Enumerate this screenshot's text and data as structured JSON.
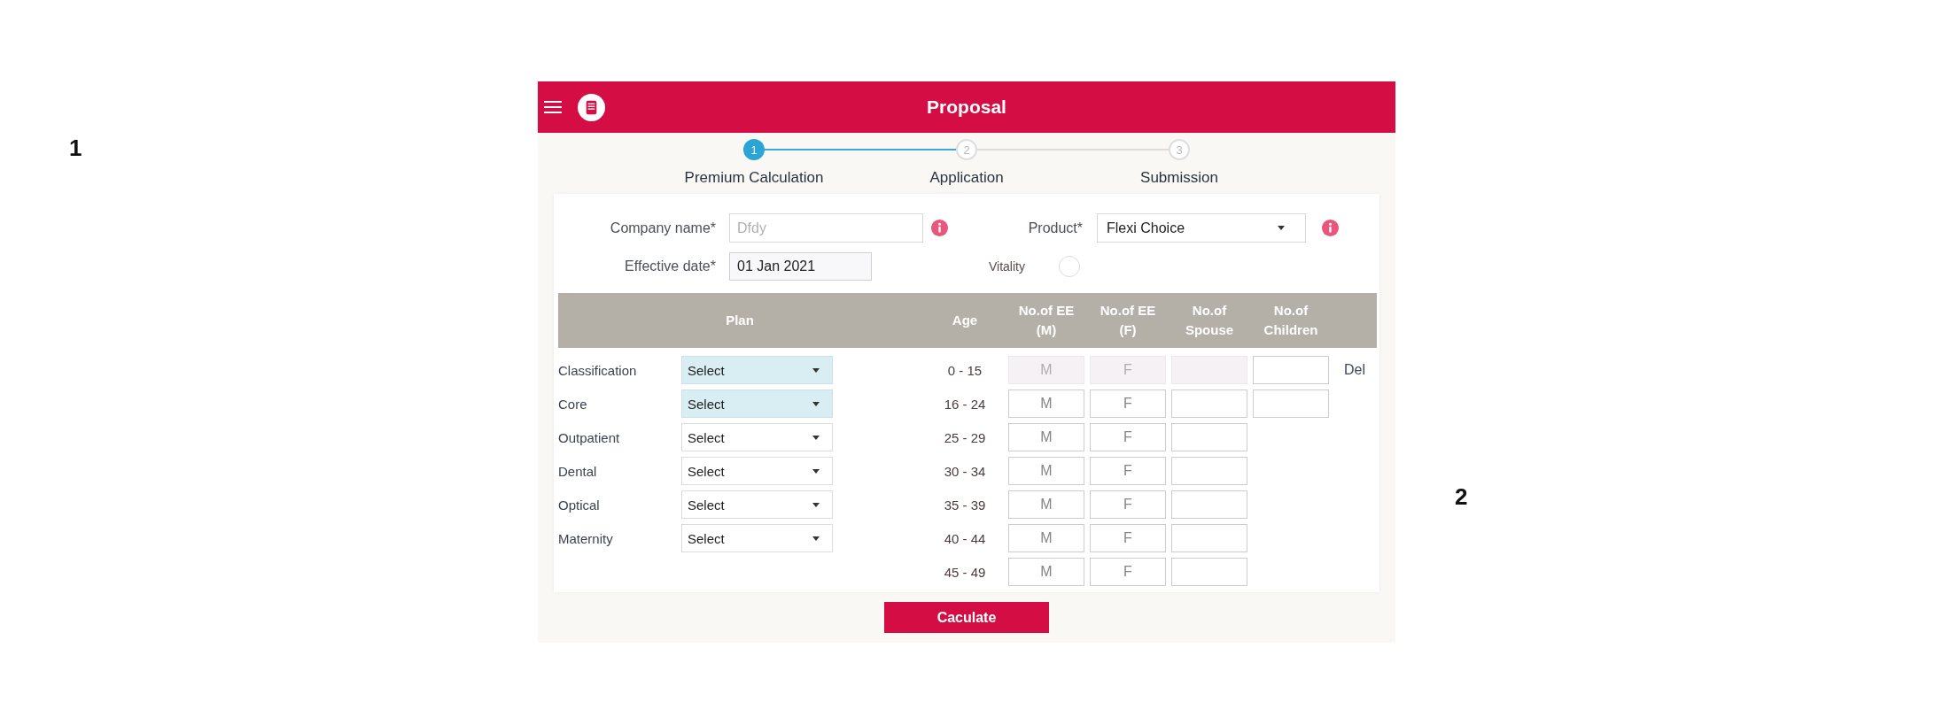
{
  "annotations": [
    "1",
    "2"
  ],
  "header": {
    "title": "Proposal"
  },
  "stepper": [
    {
      "number": "1",
      "label": "Premium Calculation",
      "selected": true
    },
    {
      "number": "2",
      "label": "Application",
      "selected": false
    },
    {
      "number": "3",
      "label": "Submission",
      "selected": false
    }
  ],
  "form": {
    "company_name": {
      "label": "Company name*",
      "placeholder": "Dfdy"
    },
    "product": {
      "label": "Product*",
      "value": "Flexi Choice"
    },
    "effective_date": {
      "label": "Effective date*",
      "value": "01 Jan 2021"
    },
    "vitality": {
      "label": "Vitality",
      "checked": false
    }
  },
  "table": {
    "columns": [
      "Plan",
      "Age",
      "No.of EE (M)",
      "No.of EE (F)",
      "No.of Spouse",
      "No.of Children"
    ],
    "plans": [
      {
        "label": "Classification",
        "value": "Select",
        "highlighted": true
      },
      {
        "label": "Core",
        "value": "Select",
        "highlighted": true
      },
      {
        "label": "Outpatient",
        "value": "Select",
        "highlighted": false
      },
      {
        "label": "Dental",
        "value": "Select",
        "highlighted": false
      },
      {
        "label": "Optical",
        "value": "Select",
        "highlighted": false
      },
      {
        "label": "Maternity",
        "value": "Select",
        "highlighted": false
      }
    ],
    "age_bands": [
      {
        "age": "0 - 15",
        "fields": [
          {
            "placeholder": "M",
            "disabled": true
          },
          {
            "placeholder": "F",
            "disabled": true
          },
          {
            "disabled": true
          },
          {
            "disabled": false
          }
        ],
        "delete_label": "Del"
      },
      {
        "age": "16 - 24",
        "fields": [
          {
            "placeholder": "M",
            "disabled": false
          },
          {
            "placeholder": "F",
            "disabled": false
          },
          {
            "disabled": false
          },
          {
            "disabled": false
          }
        ]
      },
      {
        "age": "25 - 29",
        "fields": [
          {
            "placeholder": "M",
            "disabled": false
          },
          {
            "placeholder": "F",
            "disabled": false
          },
          {
            "disabled": false
          }
        ]
      },
      {
        "age": "30 - 34",
        "fields": [
          {
            "placeholder": "M",
            "disabled": false
          },
          {
            "placeholder": "F",
            "disabled": false
          },
          {
            "disabled": false
          }
        ]
      },
      {
        "age": "35 - 39",
        "fields": [
          {
            "placeholder": "M",
            "disabled": false
          },
          {
            "placeholder": "F",
            "disabled": false
          },
          {
            "disabled": false
          }
        ]
      },
      {
        "age": "40 - 44",
        "fields": [
          {
            "placeholder": "M",
            "disabled": false
          },
          {
            "placeholder": "F",
            "disabled": false
          },
          {
            "disabled": false
          }
        ]
      },
      {
        "age": "45 - 49",
        "fields": [
          {
            "placeholder": "M",
            "disabled": false
          },
          {
            "placeholder": "F",
            "disabled": false
          },
          {
            "disabled": false
          }
        ]
      }
    ]
  },
  "calculate_button": "Caculate"
}
